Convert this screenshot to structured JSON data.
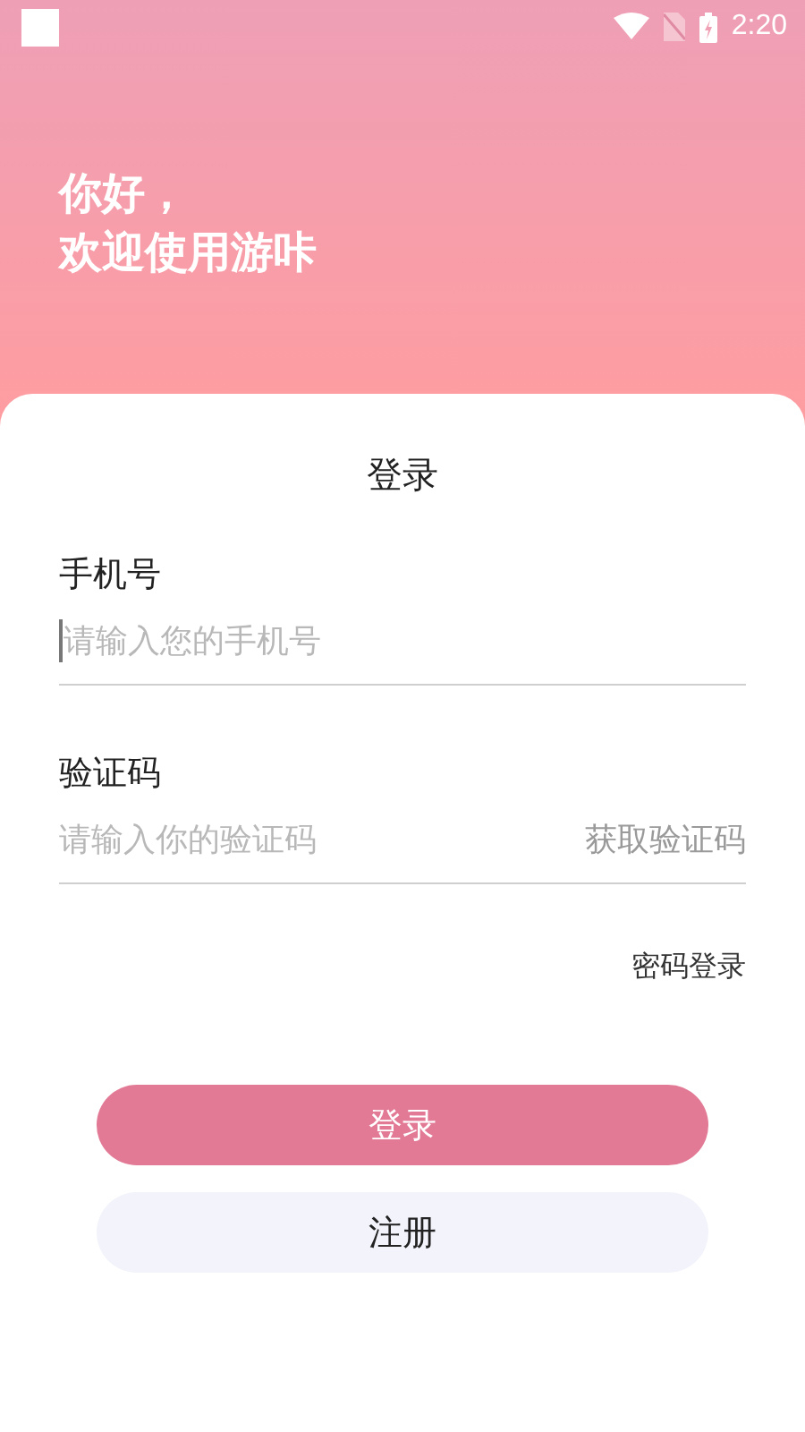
{
  "status_bar": {
    "time": "2:20"
  },
  "greeting": [
    "你好，",
    "欢迎使用游咔"
  ],
  "title": "登录",
  "fields": [
    {
      "label": "手机号",
      "placeholder": "请输入您的手机号",
      "focused": true
    },
    {
      "label": "验证码",
      "placeholder": "请输入你的验证码",
      "focused": false,
      "action": "获取验证码"
    }
  ],
  "alt_login": "密码登录",
  "buttons": [
    {
      "label": "登录",
      "kind": "primary"
    },
    {
      "label": "注册",
      "kind": "secondary"
    }
  ]
}
